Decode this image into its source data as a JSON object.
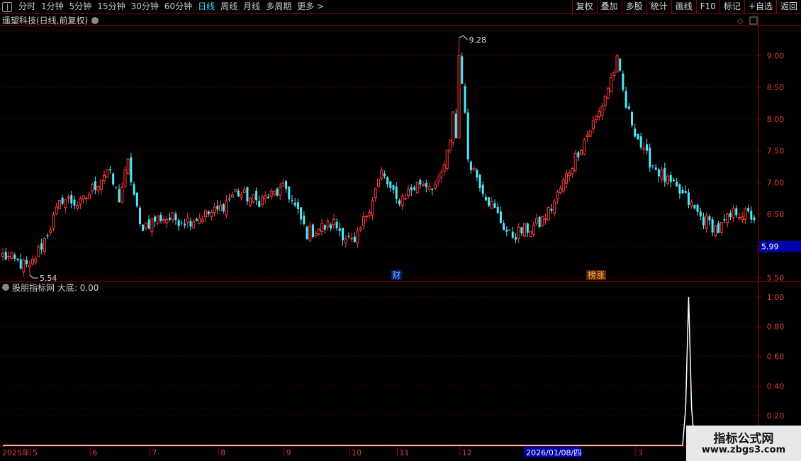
{
  "toolbar": {
    "periods": [
      "分时",
      "1分钟",
      "5分钟",
      "15分钟",
      "30分钟",
      "60分钟",
      "日线",
      "周线",
      "月线",
      "多周期",
      "更多 >"
    ],
    "active_index": 6,
    "buttons": [
      "复权",
      "叠加",
      "多股",
      "统计",
      "画线",
      "F10",
      "标记",
      "+自选",
      "返回"
    ]
  },
  "colors": {
    "up": "#ff3a3a",
    "down": "#4fe8f8",
    "grid": "#5a0000",
    "axis": "#b00000",
    "price_tag_bg": "#0000a8",
    "indicator_line": "#ffffff"
  },
  "chart_data": [
    {
      "type": "candlestick",
      "title": "遥望科技(日线,前复权)",
      "ylim": [
        5.45,
        9.45
      ],
      "yticks": [
        5.5,
        6.0,
        6.5,
        7.0,
        7.5,
        8.0,
        8.5,
        9.0
      ],
      "ytick_labels": [
        "5.50",
        "6.00",
        "6.50",
        "7.00",
        "7.50",
        "8.00",
        "8.50",
        "9.00"
      ],
      "current_price": "5.99",
      "max_label": "9.28",
      "min_label": "5.54",
      "markers": [
        {
          "text": "财",
          "date_index": 132
        },
        {
          "text": "榜涨",
          "date_index": 199
        }
      ],
      "waypoints": [
        [
          0,
          5.85
        ],
        [
          9,
          5.65
        ],
        [
          14,
          6.1
        ],
        [
          20,
          6.75
        ],
        [
          26,
          6.65
        ],
        [
          35,
          7.2
        ],
        [
          39,
          6.75
        ],
        [
          42,
          7.3
        ],
        [
          46,
          6.3
        ],
        [
          53,
          6.45
        ],
        [
          62,
          6.4
        ],
        [
          72,
          6.55
        ],
        [
          78,
          6.85
        ],
        [
          85,
          6.7
        ],
        [
          95,
          6.9
        ],
        [
          102,
          6.2
        ],
        [
          111,
          6.35
        ],
        [
          118,
          6.0
        ],
        [
          127,
          7.15
        ],
        [
          132,
          6.7
        ],
        [
          140,
          7.0
        ],
        [
          146,
          6.95
        ],
        [
          150,
          7.6
        ],
        [
          153,
          9.25
        ],
        [
          156,
          7.4
        ],
        [
          162,
          6.8
        ],
        [
          170,
          6.15
        ],
        [
          180,
          6.35
        ],
        [
          184,
          6.6
        ],
        [
          193,
          7.5
        ],
        [
          200,
          8.1
        ],
        [
          206,
          8.9
        ],
        [
          209,
          8.2
        ],
        [
          215,
          7.45
        ],
        [
          223,
          7.0
        ],
        [
          229,
          6.75
        ],
        [
          234,
          6.45
        ],
        [
          240,
          6.25
        ],
        [
          246,
          6.55
        ],
        [
          252,
          6.45
        ]
      ]
    },
    {
      "type": "line",
      "title": "股朋指标网 大底: 0.00",
      "ylim": [
        0,
        1.1
      ],
      "yticks": [
        0.2,
        0.4,
        0.6,
        0.8,
        1.0
      ],
      "ytick_labels": [
        "0.20",
        "0.40",
        "0.60",
        "0.80",
        "1.00"
      ],
      "spike_index": 230,
      "spike_value": 1.0
    }
  ],
  "time_axis": {
    "labels": [
      {
        "text": "2025年",
        "date_index": 0
      },
      {
        "text": "5",
        "date_index": 10
      },
      {
        "text": "6",
        "date_index": 30
      },
      {
        "text": "7",
        "date_index": 50
      },
      {
        "text": "8",
        "date_index": 73
      },
      {
        "text": "9",
        "date_index": 95
      },
      {
        "text": "10",
        "date_index": 117
      },
      {
        "text": "11",
        "date_index": 133
      },
      {
        "text": "12",
        "date_index": 154
      },
      {
        "text": "1",
        "date_index": 177
      },
      {
        "text": "3",
        "date_index": 213
      }
    ],
    "cursor_label": "2026/01/08/四",
    "cursor_index": 180
  },
  "watermark": {
    "line1": "指标公式网",
    "line2": "www.zbgs3.com"
  }
}
